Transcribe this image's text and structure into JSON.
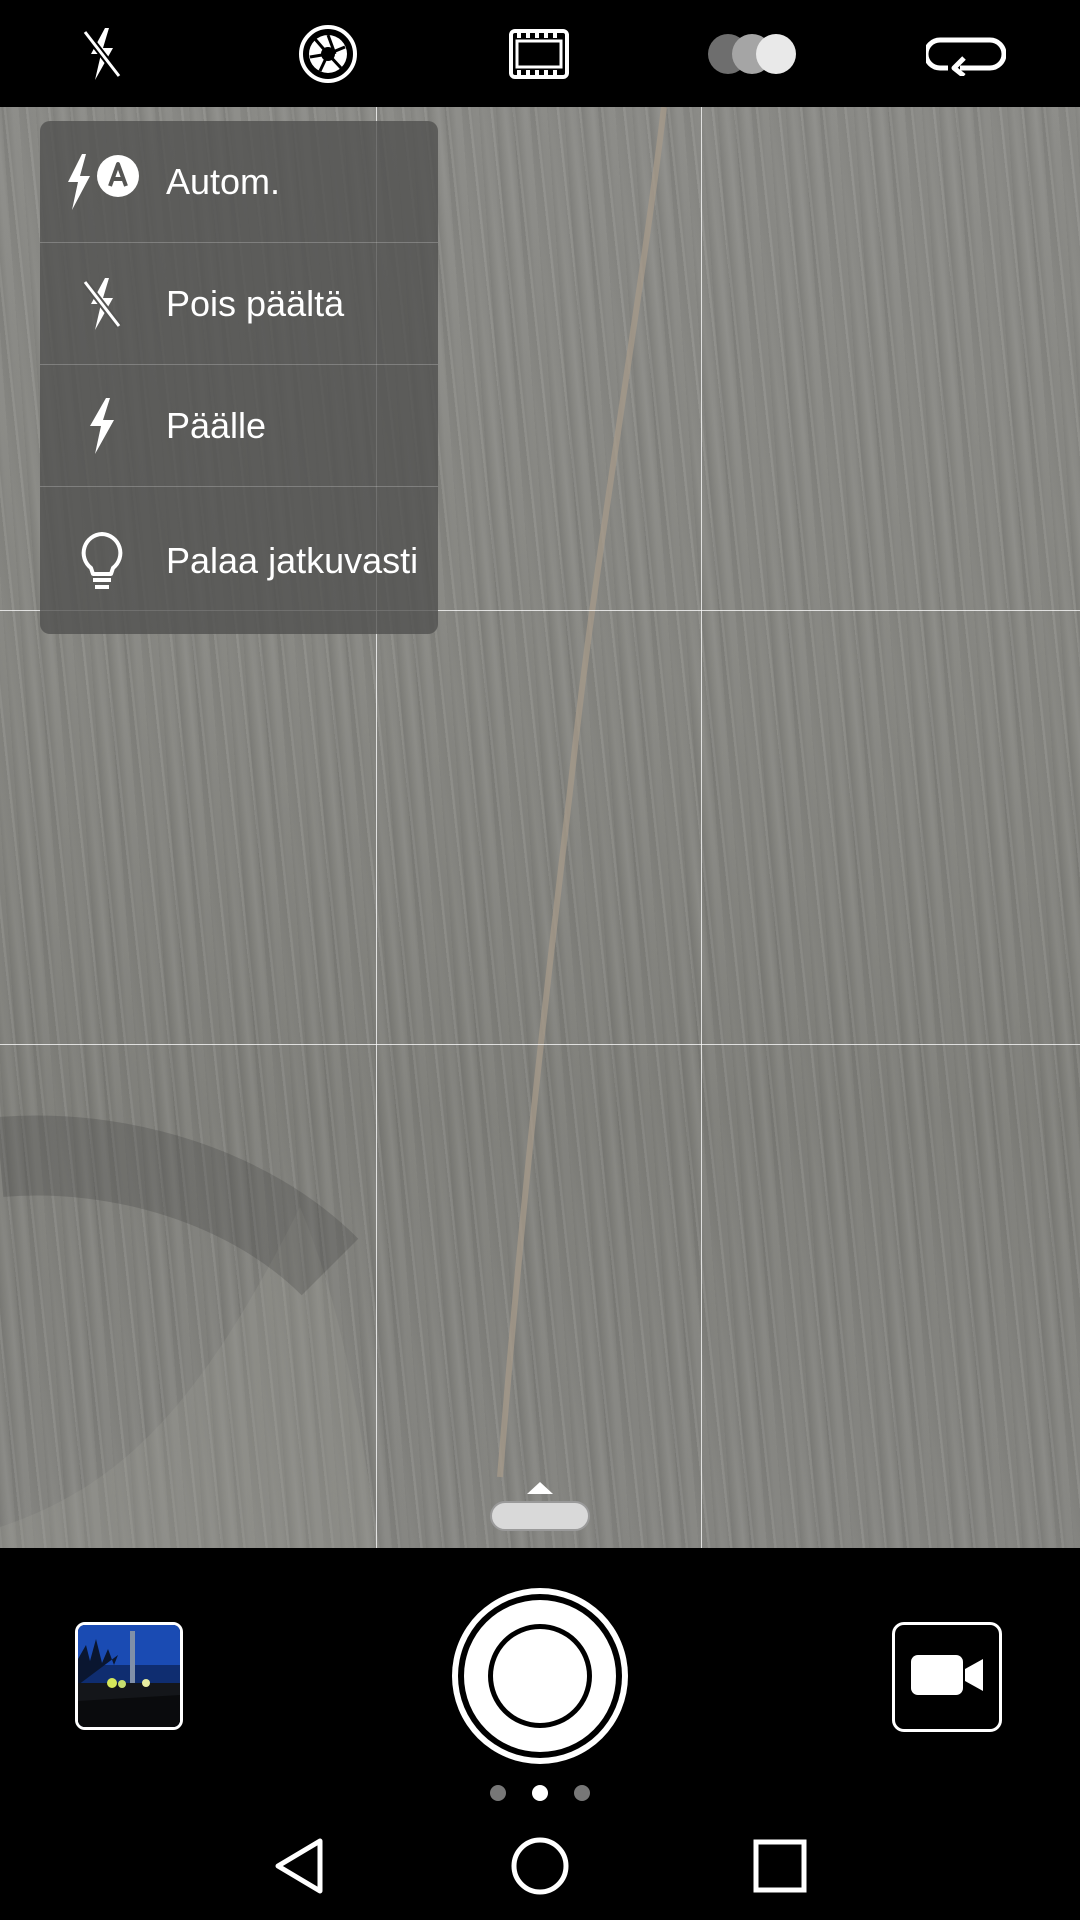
{
  "top_toolbar": {
    "flash_icon": "flash-off-icon",
    "aperture_icon": "aperture-icon",
    "film_icon": "film-filter-icon",
    "color_mode_icon": "color-effects-icon",
    "switch_camera_icon": "switch-camera-icon"
  },
  "flash_menu": {
    "items": [
      {
        "label": "Autom.",
        "icon": "flash-auto-icon"
      },
      {
        "label": "Pois päältä",
        "icon": "flash-off-icon"
      },
      {
        "label": "Päälle",
        "icon": "flash-on-icon"
      },
      {
        "label": "Palaa jatkuvasti",
        "icon": "torch-bulb-icon"
      }
    ]
  },
  "bottom": {
    "gallery_thumbnail": "gallery-thumbnail",
    "shutter": "shutter-button",
    "video_icon": "video-camera-icon",
    "page_indicator": {
      "count": 3,
      "active_index": 1
    }
  },
  "navigation": {
    "back_icon": "back-triangle-icon",
    "home_icon": "home-circle-icon",
    "recents_icon": "recents-square-icon"
  },
  "colors": {
    "bar_background": "#000000",
    "menu_background": "#50504e",
    "text": "#ffffff",
    "inactive_dot": "#777777"
  }
}
